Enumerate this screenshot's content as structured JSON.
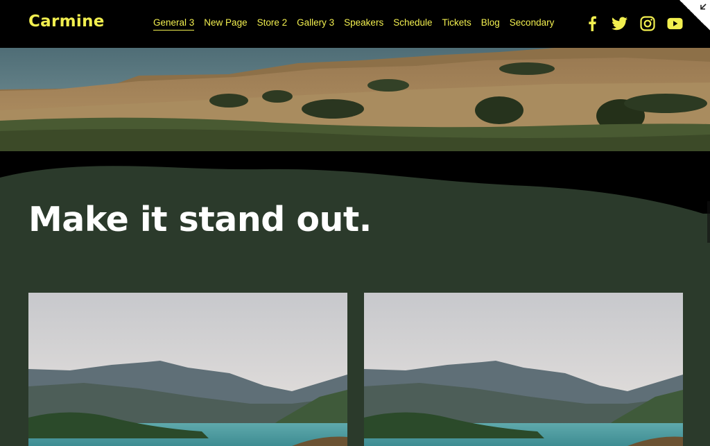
{
  "site": {
    "logo": "Carmine"
  },
  "nav": {
    "items": [
      {
        "label": "General 3",
        "active": true
      },
      {
        "label": "New Page",
        "active": false
      },
      {
        "label": "Store 2",
        "active": false
      },
      {
        "label": "Gallery 3",
        "active": false
      },
      {
        "label": "Speakers",
        "active": false
      },
      {
        "label": "Schedule",
        "active": false
      },
      {
        "label": "Tickets",
        "active": false
      },
      {
        "label": "Blog",
        "active": false
      },
      {
        "label": "Secondary",
        "active": false
      }
    ]
  },
  "socials": [
    {
      "icon": "facebook-icon"
    },
    {
      "icon": "twitter-icon"
    },
    {
      "icon": "instagram-icon"
    },
    {
      "icon": "youtube-icon"
    }
  ],
  "hero": {
    "headline": "Make it stand out."
  },
  "colors": {
    "accent": "#f2ef4f",
    "header_bg": "#000000",
    "section_bg": "#2b3a2b",
    "headline": "#ffffff"
  }
}
